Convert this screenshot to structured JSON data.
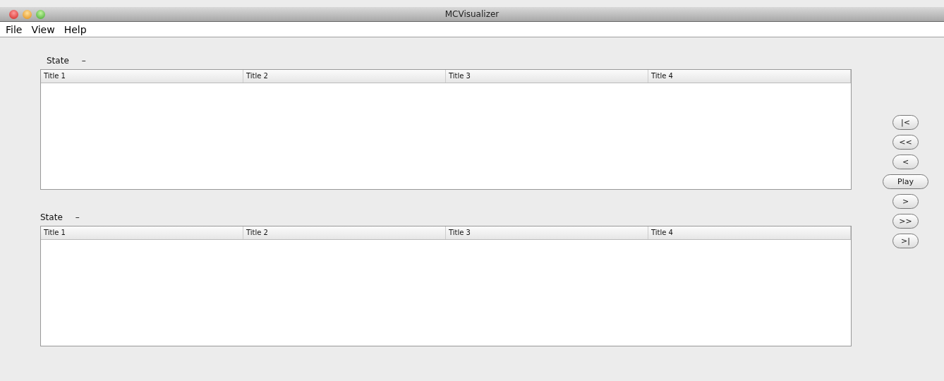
{
  "window": {
    "title": "MCVisualizer"
  },
  "menu": [
    "File",
    "View",
    "Help"
  ],
  "panels": [
    {
      "label": "State",
      "value": "–",
      "columns": [
        "Title 1",
        "Title 2",
        "Title 3",
        "Title 4"
      ]
    },
    {
      "label": "State",
      "value": "–",
      "columns": [
        "Title 1",
        "Title 2",
        "Title 3",
        "Title 4"
      ]
    }
  ],
  "controls": [
    {
      "label": "|<",
      "kind": "small"
    },
    {
      "label": "<<",
      "kind": "small"
    },
    {
      "label": "<",
      "kind": "small"
    },
    {
      "label": "Play",
      "kind": "wide"
    },
    {
      "label": ">",
      "kind": "small"
    },
    {
      "label": ">>",
      "kind": "small"
    },
    {
      "label": ">|",
      "kind": "small"
    }
  ]
}
